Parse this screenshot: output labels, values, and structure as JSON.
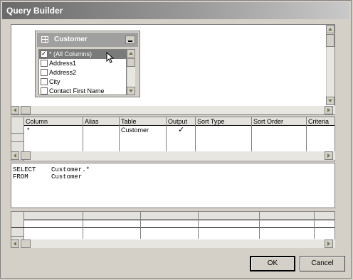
{
  "window": {
    "title": "Query Builder"
  },
  "table_window": {
    "title": "Customer",
    "items": [
      {
        "label": "* (All Columns)",
        "checked": true,
        "selected": true
      },
      {
        "label": "Address1",
        "checked": false,
        "selected": false
      },
      {
        "label": "Address2",
        "checked": false,
        "selected": false
      },
      {
        "label": "City",
        "checked": false,
        "selected": false
      },
      {
        "label": "Contact First Name",
        "checked": false,
        "selected": false
      }
    ]
  },
  "criteria_grid": {
    "headers": [
      "Column",
      "Alias",
      "Table",
      "Output",
      "Sort Type",
      "Sort Order",
      "Criteria"
    ],
    "rows": [
      {
        "column": "*",
        "alias": "",
        "table": "Customer",
        "output": "✓",
        "sort_type": "",
        "sort_order": "",
        "criteria": ""
      }
    ]
  },
  "sql": {
    "line1": "SELECT    Customer.*",
    "line2": "FROM      Customer"
  },
  "buttons": {
    "ok": "OK",
    "cancel": "Cancel"
  }
}
